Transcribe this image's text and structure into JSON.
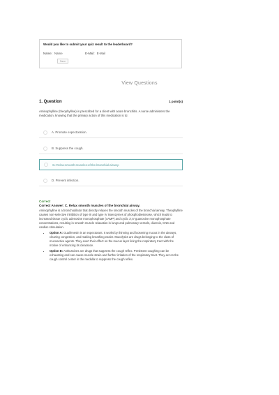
{
  "leaderboard": {
    "title": "Would you like to submit your quiz result to the leaderboard?",
    "name_label": "Name:",
    "name_value": "Name",
    "email_label": "E-Mail:",
    "email_value": "E-Mail",
    "submit_label": "Save"
  },
  "view_questions": "View Questions",
  "question": {
    "number_title": "1. Question",
    "points": "1 point(s)",
    "text": "Aminophylline (theophylline) is prescribed for a client with acute bronchitis. A nurse administers the medication, knowing that the primary action of this medication is to:",
    "options": [
      {
        "label": "A. Promote expectoration."
      },
      {
        "label": "B. Suppress the cough."
      },
      {
        "label": "C. Relax smooth muscles of the bronchial airway."
      },
      {
        "label": "D. Prevent infection."
      }
    ]
  },
  "explanation": {
    "status": "Correct",
    "answer": "Correct Answer: C. Relax smooth muscles of the bronchial airway.",
    "body": "Aminophylline is a bronchodilator that directly relaxes the smooth muscles of the bronchial airway. Theophylline causes non-selective inhibition of type III and type IV isoenzymes of phosphodiesterase, which leads to increased tissue cyclic adenosine monophosphate (cAMP) and cyclic 3',5'-guanosine monophosphate concentrations, resulting in smooth muscle relaxation in lungs and pulmonary vessels, diuresis, CNS and cardiac stimulation.",
    "bullets": [
      {
        "head": "Option A:",
        "text": " Guaifenesin is an expectorant. It works by thinning and loosening mucus in the airways, clearing congestion, and making breathing easier. Mucolytics are drugs belonging to the class of mucoactive agents. They exert their effect on the mucus layer lining the respiratory tract with the motive of enhancing its clearance."
      },
      {
        "head": "Option B:",
        "text": " Antitussives are drugs that suppress the cough reflex. Persistent coughing can be exhausting and can cause muscle strain and further irritation of the respiratory tract. They act on the cough control center in the medulla to suppress the cough reflex."
      }
    ]
  }
}
